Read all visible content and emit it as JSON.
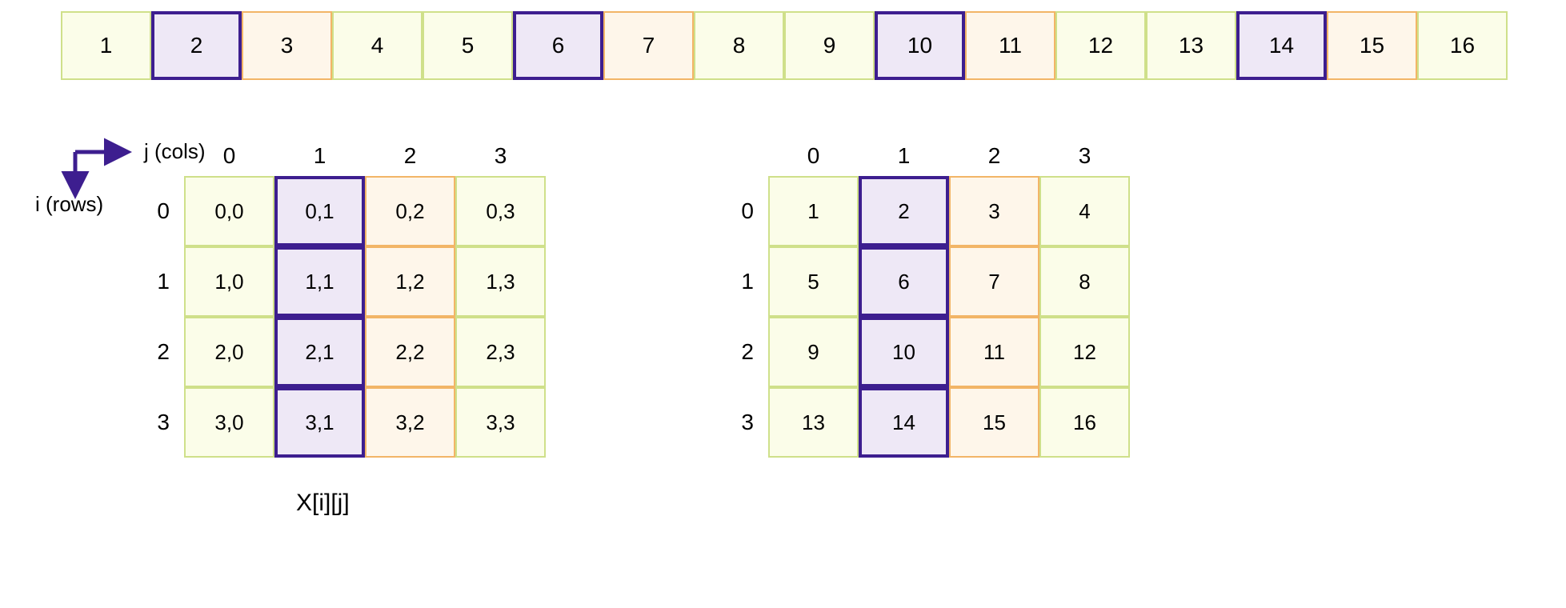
{
  "axis": {
    "j_label": "j (cols)",
    "i_label": "i (rows)"
  },
  "caption": "X[i][j]",
  "strip": {
    "cells": [
      {
        "v": "1",
        "c": "c-green"
      },
      {
        "v": "2",
        "c": "c-purple"
      },
      {
        "v": "3",
        "c": "c-orange"
      },
      {
        "v": "4",
        "c": "c-green"
      },
      {
        "v": "5",
        "c": "c-green"
      },
      {
        "v": "6",
        "c": "c-purple"
      },
      {
        "v": "7",
        "c": "c-orange"
      },
      {
        "v": "8",
        "c": "c-green"
      },
      {
        "v": "9",
        "c": "c-green"
      },
      {
        "v": "10",
        "c": "c-purple"
      },
      {
        "v": "11",
        "c": "c-orange"
      },
      {
        "v": "12",
        "c": "c-green"
      },
      {
        "v": "13",
        "c": "c-green"
      },
      {
        "v": "14",
        "c": "c-purple"
      },
      {
        "v": "15",
        "c": "c-orange"
      },
      {
        "v": "16",
        "c": "c-green"
      }
    ]
  },
  "matrix_left": {
    "col_headers": [
      "0",
      "1",
      "2",
      "3"
    ],
    "row_headers": [
      "0",
      "1",
      "2",
      "3"
    ],
    "rows": [
      [
        "0,0",
        "0,1",
        "0,2",
        "0,3"
      ],
      [
        "1,0",
        "1,1",
        "1,2",
        "1,3"
      ],
      [
        "2,0",
        "2,1",
        "2,2",
        "2,3"
      ],
      [
        "3,0",
        "3,1",
        "3,2",
        "3,3"
      ]
    ]
  },
  "matrix_right": {
    "col_headers": [
      "0",
      "1",
      "2",
      "3"
    ],
    "row_headers": [
      "0",
      "1",
      "2",
      "3"
    ],
    "rows": [
      [
        "1",
        "2",
        "3",
        "4"
      ],
      [
        "5",
        "6",
        "7",
        "8"
      ],
      [
        "9",
        "10",
        "11",
        "12"
      ],
      [
        "13",
        "14",
        "15",
        "16"
      ]
    ]
  }
}
